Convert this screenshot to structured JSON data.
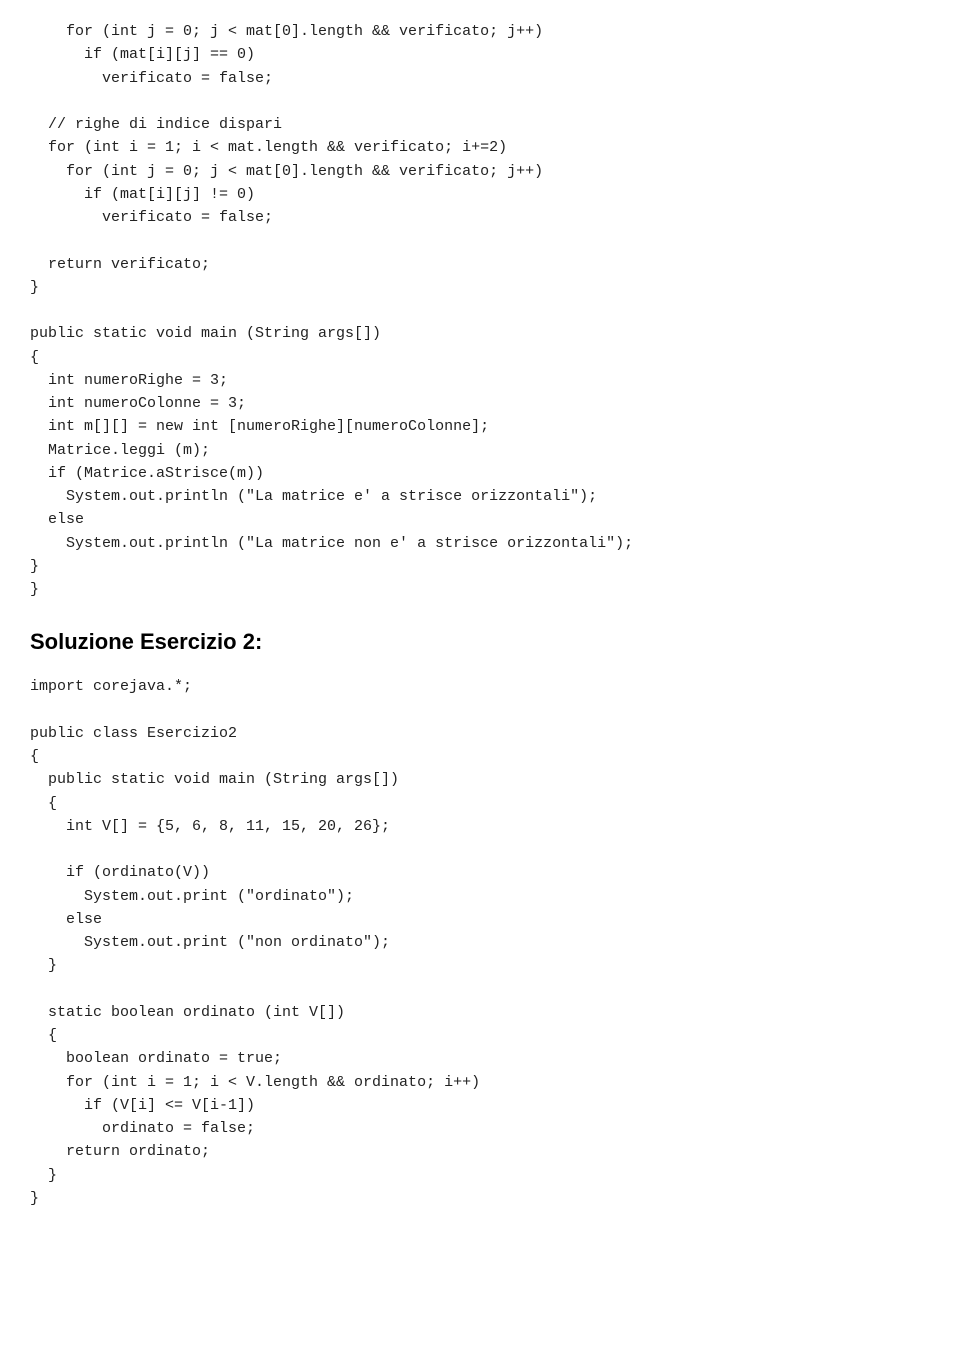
{
  "content": {
    "code_block_1": "    for (int j = 0; j < mat[0].length && verificato; j++)\n      if (mat[i][j] == 0)\n        verificato = false;\n\n  // righe di indice dispari\n  for (int i = 1; i < mat.length && verificato; i+=2)\n    for (int j = 0; j < mat[0].length && verificato; j++)\n      if (mat[i][j] != 0)\n        verificato = false;\n\n  return verificato;\n}\n\npublic static void main (String args[])\n{\n  int numeroRighe = 3;\n  int numeroColonne = 3;\n  int m[][] = new int [numeroRighe][numeroColonne];\n  Matrice.leggi (m);\n  if (Matrice.aStrisce(m))\n    System.out.println (\"La matrice e' a strisce orizzontali\");\n  else\n    System.out.println (\"La matrice non e' a strisce orizzontali\");\n}\n}",
    "section2_heading": "Soluzione Esercizio 2:",
    "code_block_2": "import corejava.*;\n\npublic class Esercizio2\n{\n  public static void main (String args[])\n  {\n    int V[] = {5, 6, 8, 11, 15, 20, 26};\n\n    if (ordinato(V))\n      System.out.print (\"ordinato\");\n    else\n      System.out.print (\"non ordinato\");\n  }\n\n  static boolean ordinato (int V[])\n  {\n    boolean ordinato = true;\n    for (int i = 1; i < V.length && ordinato; i++)\n      if (V[i] <= V[i-1])\n        ordinato = false;\n    return ordinato;\n  }\n}"
  }
}
